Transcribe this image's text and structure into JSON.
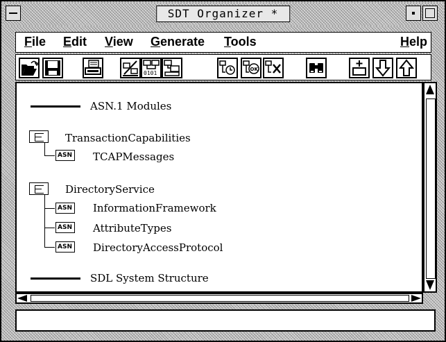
{
  "window": {
    "title": "SDT Organizer *"
  },
  "menu": {
    "file": "File",
    "edit": "Edit",
    "view": "View",
    "generate": "Generate",
    "tools": "Tools",
    "help": "Help"
  },
  "toolbar": {
    "buttons": [
      "open-icon",
      "save-icon",
      "print-icon",
      "edit-diagram-icon",
      "generate-icon",
      "structure-icon",
      "analyze-icon",
      "analyze-ok-icon",
      "analyze-error-icon",
      "binoculars-icon",
      "add-icon",
      "arrow-down-icon",
      "arrow-up-icon"
    ]
  },
  "tree": {
    "asn_modules_label": "ASN.1 Modules",
    "groups": [
      {
        "name": "TransactionCapabilities",
        "items": [
          "TCAPMessages"
        ]
      },
      {
        "name": "DirectoryService",
        "items": [
          "InformationFramework",
          "AttributeTypes",
          "DirectoryAccessProtocol"
        ]
      }
    ],
    "sdl_label": "SDL System Structure",
    "asn_badge": "ASN"
  },
  "status": {
    "text": ""
  }
}
